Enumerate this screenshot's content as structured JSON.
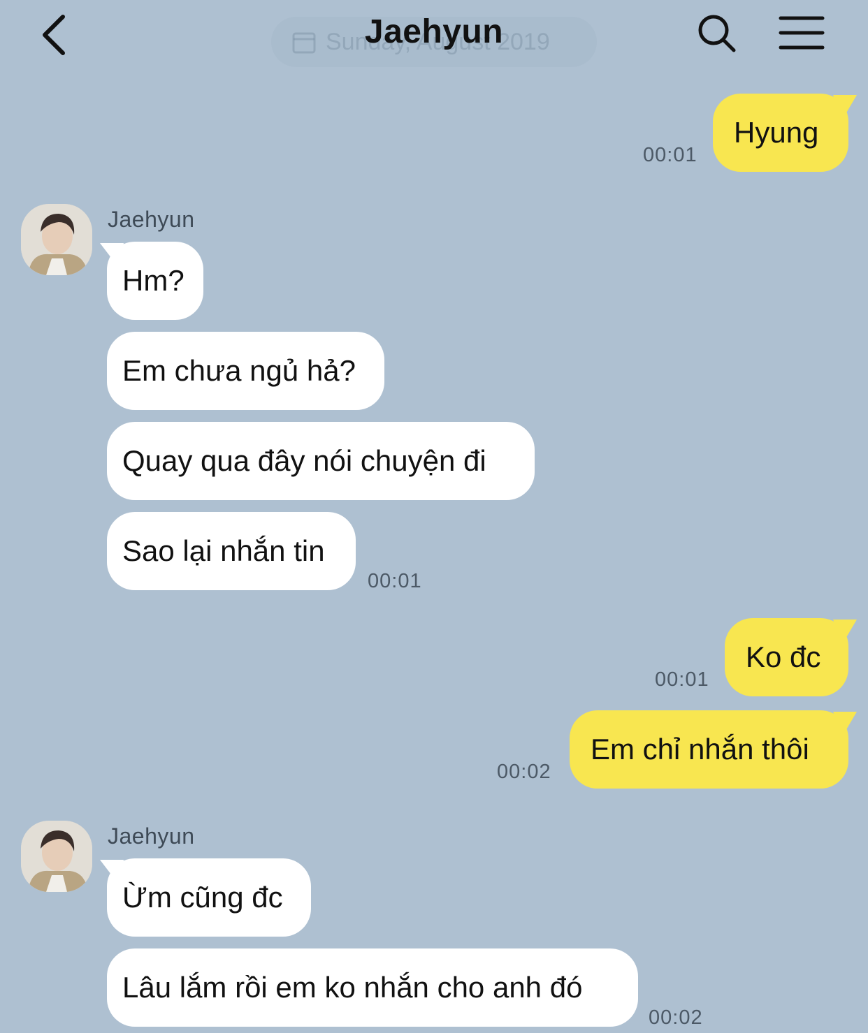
{
  "header": {
    "title": "Jaehyun",
    "date_pill": "Sunday, August 2019"
  },
  "colors": {
    "background": "#aec0d1",
    "incoming_bubble": "#ffffff",
    "outgoing_bubble": "#f8e650"
  },
  "icons": {
    "back": "chevron-left-icon",
    "search": "search-icon",
    "menu": "hamburger-menu-icon",
    "date": "calendar-icon"
  },
  "messages": {
    "m1": {
      "text": "Hyung",
      "time": "00:01",
      "direction": "out"
    },
    "g1": {
      "sender": "Jaehyun"
    },
    "m2": {
      "text": "Hm?",
      "direction": "in"
    },
    "m3": {
      "text": "Em chưa ngủ hả?",
      "direction": "in"
    },
    "m4": {
      "text": "Quay qua đây nói chuyện đi",
      "direction": "in"
    },
    "m5": {
      "text": "Sao lại nhắn tin",
      "time": "00:01",
      "direction": "in"
    },
    "m6": {
      "text": "Ko đc",
      "time": "00:01",
      "direction": "out"
    },
    "m7": {
      "text": "Em chỉ nhắn thôi",
      "time": "00:02",
      "direction": "out"
    },
    "g2": {
      "sender": "Jaehyun"
    },
    "m8": {
      "text": "Ừm cũng đc",
      "direction": "in"
    },
    "m9": {
      "text": "Lâu lắm rồi em ko nhắn cho anh đó",
      "time": "00:02",
      "direction": "in"
    }
  }
}
